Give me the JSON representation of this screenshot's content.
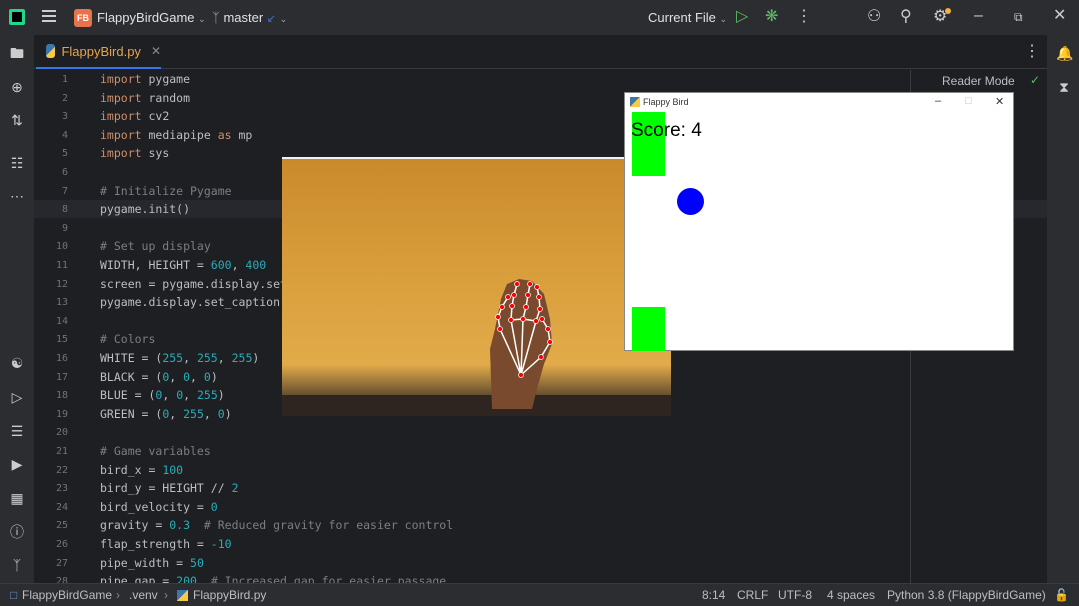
{
  "titlebar": {
    "project_badge": "FB",
    "project_name": "FlappyBirdGame",
    "branch": "master",
    "run_config": "Current File"
  },
  "tab": {
    "label": "FlappyBird.py"
  },
  "editor": {
    "reader_mode": "Reader Mode",
    "lines": [
      {
        "n": "1",
        "code": "import pygame"
      },
      {
        "n": "2",
        "code": "import random"
      },
      {
        "n": "3",
        "code": "import cv2"
      },
      {
        "n": "4",
        "code": "import mediapipe as mp"
      },
      {
        "n": "5",
        "code": "import sys"
      },
      {
        "n": "6",
        "code": ""
      },
      {
        "n": "7",
        "code": "# Initialize Pygame"
      },
      {
        "n": "8",
        "code": "pygame.init()"
      },
      {
        "n": "9",
        "code": ""
      },
      {
        "n": "10",
        "code": "# Set up display"
      },
      {
        "n": "11",
        "code": "WIDTH, HEIGHT = 600, 400"
      },
      {
        "n": "12",
        "code": "screen = pygame.display.set"
      },
      {
        "n": "13",
        "code": "pygame.display.set_caption("
      },
      {
        "n": "14",
        "code": ""
      },
      {
        "n": "15",
        "code": "# Colors"
      },
      {
        "n": "16",
        "code": "WHITE = (255, 255, 255)"
      },
      {
        "n": "17",
        "code": "BLACK = (0, 0, 0)"
      },
      {
        "n": "18",
        "code": "BLUE = (0, 0, 255)"
      },
      {
        "n": "19",
        "code": "GREEN = (0, 255, 0)"
      },
      {
        "n": "20",
        "code": ""
      },
      {
        "n": "21",
        "code": "# Game variables"
      },
      {
        "n": "22",
        "code": "bird_x = 100"
      },
      {
        "n": "23",
        "code": "bird_y = HEIGHT // 2"
      },
      {
        "n": "24",
        "code": "bird_velocity = 0"
      },
      {
        "n": "25",
        "code": "gravity = 0.3  # Reduced gravity for easier control"
      },
      {
        "n": "26",
        "code": "flap_strength = -10"
      },
      {
        "n": "27",
        "code": "pipe_width = 50"
      },
      {
        "n": "28",
        "code": "pipe_gap = 200  # Increased gap for easier passage"
      }
    ]
  },
  "flappy_window": {
    "title": "Flappy Bird",
    "score_text": "Score: 4"
  },
  "statusbar": {
    "crumb_project": "FlappyBirdGame",
    "crumb_venv": ".venv",
    "crumb_file": "FlappyBird.py",
    "position": "8:14",
    "line_sep": "CRLF",
    "encoding": "UTF-8",
    "indent": "4 spaces",
    "interpreter": "Python 3.8 (FlappyBirdGame)"
  },
  "colors": {
    "accent": "#3574f0",
    "pipe": "#00ff00",
    "bird": "#0000ff",
    "landmark": "#ff0000"
  }
}
